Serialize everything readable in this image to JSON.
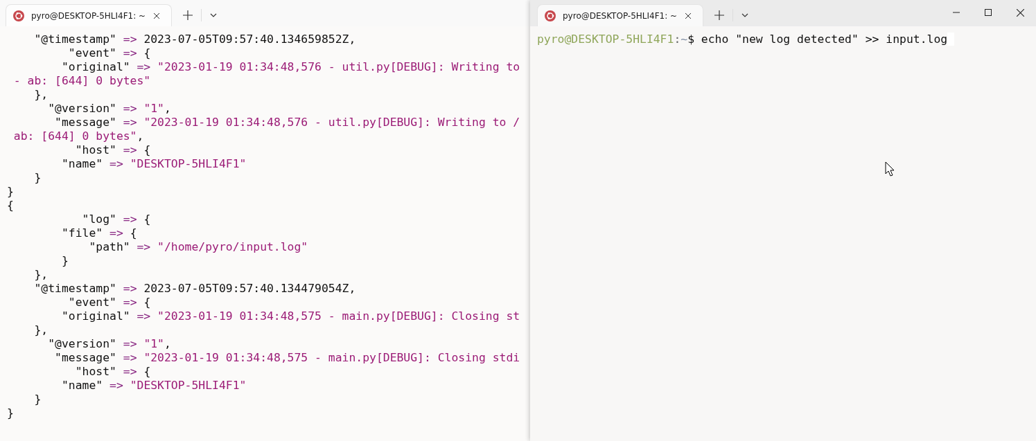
{
  "left_terminal": {
    "tab_title": "pyro@DESKTOP-5HLI4F1: ~",
    "lines": [
      [
        {
          "kind": "plain",
          "text": "    \"@timestamp\" "
        },
        {
          "kind": "op",
          "text": "=>"
        },
        {
          "kind": "plain",
          "text": " 2023-07-05T09:57:40.134659852Z,"
        }
      ],
      [
        {
          "kind": "plain",
          "text": "         \"event\" "
        },
        {
          "kind": "op",
          "text": "=>"
        },
        {
          "kind": "plain",
          "text": " {"
        }
      ],
      [
        {
          "kind": "plain",
          "text": "        \"original\" "
        },
        {
          "kind": "op",
          "text": "=>"
        },
        {
          "kind": "str",
          "text": " \"2023-01-19 01:34:48,576 - util.py[DEBUG]: Writing to"
        }
      ],
      [
        {
          "kind": "str",
          "text": " - ab: [644] 0 bytes\""
        }
      ],
      [
        {
          "kind": "plain",
          "text": "    },"
        }
      ],
      [
        {
          "kind": "plain",
          "text": "      \"@version\" "
        },
        {
          "kind": "op",
          "text": "=>"
        },
        {
          "kind": "str",
          "text": " \"1\""
        },
        {
          "kind": "plain",
          "text": ","
        }
      ],
      [
        {
          "kind": "plain",
          "text": "       \"message\" "
        },
        {
          "kind": "op",
          "text": "=>"
        },
        {
          "kind": "str",
          "text": " \"2023-01-19 01:34:48,576 - util.py[DEBUG]: Writing to /"
        }
      ],
      [
        {
          "kind": "str",
          "text": " ab: [644] 0 bytes\""
        },
        {
          "kind": "plain",
          "text": ","
        }
      ],
      [
        {
          "kind": "plain",
          "text": "          \"host\" "
        },
        {
          "kind": "op",
          "text": "=>"
        },
        {
          "kind": "plain",
          "text": " {"
        }
      ],
      [
        {
          "kind": "plain",
          "text": "        \"name\" "
        },
        {
          "kind": "op",
          "text": "=>"
        },
        {
          "kind": "str",
          "text": " \"DESKTOP-5HLI4F1\""
        }
      ],
      [
        {
          "kind": "plain",
          "text": "    }"
        }
      ],
      [
        {
          "kind": "plain",
          "text": "}"
        }
      ],
      [
        {
          "kind": "plain",
          "text": "{"
        }
      ],
      [
        {
          "kind": "plain",
          "text": "           \"log\" "
        },
        {
          "kind": "op",
          "text": "=>"
        },
        {
          "kind": "plain",
          "text": " {"
        }
      ],
      [
        {
          "kind": "plain",
          "text": "        \"file\" "
        },
        {
          "kind": "op",
          "text": "=>"
        },
        {
          "kind": "plain",
          "text": " {"
        }
      ],
      [
        {
          "kind": "plain",
          "text": "            \"path\" "
        },
        {
          "kind": "op",
          "text": "=>"
        },
        {
          "kind": "str",
          "text": " \"/home/pyro/input.log\""
        }
      ],
      [
        {
          "kind": "plain",
          "text": "        }"
        }
      ],
      [
        {
          "kind": "plain",
          "text": "    },"
        }
      ],
      [
        {
          "kind": "plain",
          "text": "    \"@timestamp\" "
        },
        {
          "kind": "op",
          "text": "=>"
        },
        {
          "kind": "plain",
          "text": " 2023-07-05T09:57:40.134479054Z,"
        }
      ],
      [
        {
          "kind": "plain",
          "text": "         \"event\" "
        },
        {
          "kind": "op",
          "text": "=>"
        },
        {
          "kind": "plain",
          "text": " {"
        }
      ],
      [
        {
          "kind": "plain",
          "text": "        \"original\" "
        },
        {
          "kind": "op",
          "text": "=>"
        },
        {
          "kind": "str",
          "text": " \"2023-01-19 01:34:48,575 - main.py[DEBUG]: Closing st"
        }
      ],
      [
        {
          "kind": "plain",
          "text": "    },"
        }
      ],
      [
        {
          "kind": "plain",
          "text": "      \"@version\" "
        },
        {
          "kind": "op",
          "text": "=>"
        },
        {
          "kind": "str",
          "text": " \"1\""
        },
        {
          "kind": "plain",
          "text": ","
        }
      ],
      [
        {
          "kind": "plain",
          "text": "       \"message\" "
        },
        {
          "kind": "op",
          "text": "=>"
        },
        {
          "kind": "str",
          "text": " \"2023-01-19 01:34:48,575 - main.py[DEBUG]: Closing stdi"
        }
      ],
      [
        {
          "kind": "plain",
          "text": "          \"host\" "
        },
        {
          "kind": "op",
          "text": "=>"
        },
        {
          "kind": "plain",
          "text": " {"
        }
      ],
      [
        {
          "kind": "plain",
          "text": "        \"name\" "
        },
        {
          "kind": "op",
          "text": "=>"
        },
        {
          "kind": "str",
          "text": " \"DESKTOP-5HLI4F1\""
        }
      ],
      [
        {
          "kind": "plain",
          "text": "    }"
        }
      ],
      [
        {
          "kind": "plain",
          "text": "}"
        }
      ]
    ]
  },
  "right_terminal": {
    "tab_title": "pyro@DESKTOP-5HLI4F1: ~",
    "prompt": {
      "user_host": "pyro@DESKTOP-5HLI4F1",
      "separator": ":",
      "path": "~",
      "symbol": "$",
      "command": " echo \"new log detected\" >> input.log"
    }
  }
}
